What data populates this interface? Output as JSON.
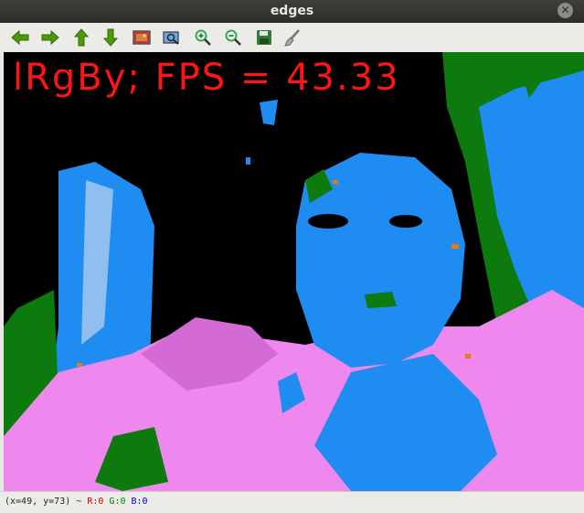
{
  "window": {
    "title": "edges"
  },
  "toolbar": {
    "buttons": [
      {
        "name": "pan-left",
        "icon": "arrow-left-icon"
      },
      {
        "name": "pan-right",
        "icon": "arrow-right-icon"
      },
      {
        "name": "pan-up",
        "icon": "arrow-up-icon"
      },
      {
        "name": "pan-down",
        "icon": "arrow-down-icon"
      },
      {
        "name": "zoom-fit",
        "icon": "image-icon"
      },
      {
        "name": "zoom-original",
        "icon": "zoom-region-icon"
      },
      {
        "name": "zoom-in",
        "icon": "zoom-in-icon"
      },
      {
        "name": "zoom-out",
        "icon": "zoom-out-icon"
      },
      {
        "name": "save",
        "icon": "floppy-icon"
      },
      {
        "name": "properties",
        "icon": "brush-icon"
      }
    ]
  },
  "image": {
    "overlay_text": "lRgBy; FPS = 43.33"
  },
  "status": {
    "coords": "(x=49, y=73) ~",
    "r": "R:0",
    "g": "G:0",
    "b": "B:0"
  },
  "colors": {
    "pink": "#ee88ee",
    "blue": "#1e8cf0",
    "green": "#0c7a0c",
    "orange": "#e87a14",
    "overlay": "#ff1414"
  }
}
